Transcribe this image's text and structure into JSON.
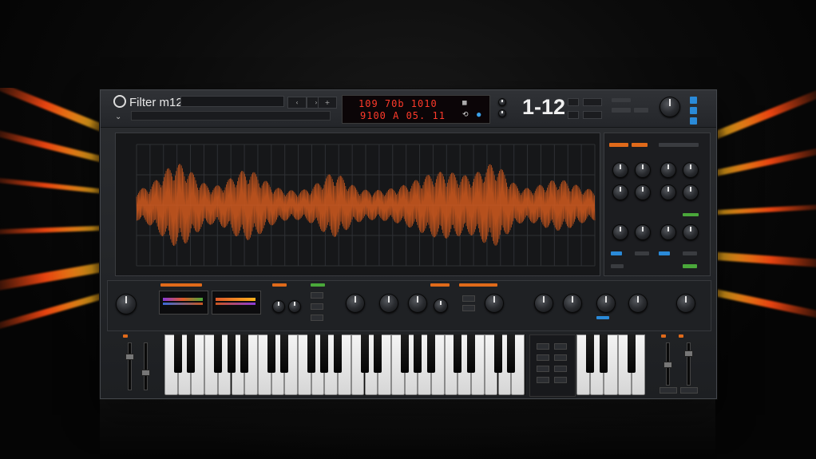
{
  "header": {
    "title": "Filter m12",
    "lcd_line1": "109  70b  1010",
    "lcd_line2": "9100 A 05. 11",
    "big_display": "1-12",
    "chevron_icon": "chevron-down-icon"
  },
  "scope": {
    "waveform_color": "#c8561e"
  },
  "colors": {
    "accent": "#e06a1a",
    "lcd": "#ff3a2a",
    "led_green": "#4aa83a",
    "led_blue": "#2a8ad8"
  }
}
